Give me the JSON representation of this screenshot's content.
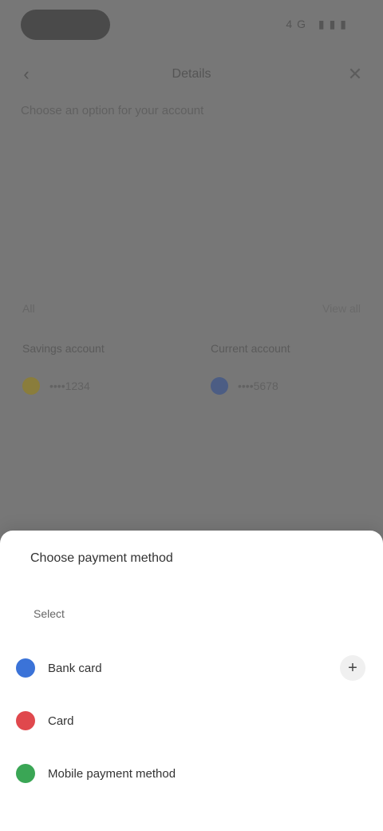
{
  "status_bar": {
    "right_text": "4G ▮▮▮"
  },
  "topbar": {
    "back_icon": "arrow-left-icon",
    "title": "Details",
    "close_icon": "close-icon"
  },
  "subheading": "Choose an option for your account",
  "section": {
    "label": "All",
    "link": "View all"
  },
  "accounts": [
    {
      "title": "Savings account",
      "value": "••••1234",
      "color": "#b5a437"
    },
    {
      "title": "Current account",
      "value": "••••5678",
      "color": "#3c5a9a"
    }
  ],
  "sheet": {
    "title": "Choose payment method",
    "subtitle": "Select",
    "options": [
      {
        "label": "Bank card",
        "color": "#3b73d8",
        "icon": "bank-card-icon",
        "action": "+"
      },
      {
        "label": "Card",
        "color": "#e0484d",
        "icon": "card-icon",
        "action": ""
      },
      {
        "label": "Mobile payment method",
        "color": "#3aa655",
        "icon": "mobile-payment-icon",
        "action": ""
      }
    ]
  },
  "colors": {
    "overlay": "#777777",
    "sheet_bg": "#ffffff"
  }
}
